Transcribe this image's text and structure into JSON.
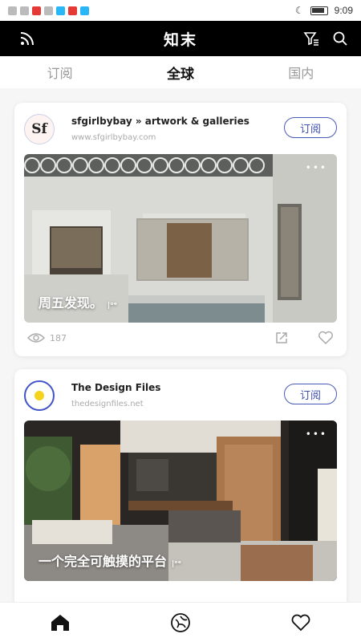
{
  "status": {
    "time": "9:09"
  },
  "app": {
    "title": "知末"
  },
  "tabs": [
    {
      "label": "订阅",
      "active": false
    },
    {
      "label": "全球",
      "active": true
    },
    {
      "label": "国内",
      "active": false
    }
  ],
  "cards": [
    {
      "avatar_text": "Sf",
      "source": "sfgirlbybay » artwork & galleries",
      "url": "www.sfgirlbybay.com",
      "subscribe_label": "订阅",
      "caption": "周五发现。",
      "views": "187"
    },
    {
      "source": "The Design Files",
      "url": "thedesignfiles.net",
      "subscribe_label": "订阅",
      "caption": "一个完全可触摸的平台"
    }
  ],
  "colors": {
    "accent": "#3d4db0",
    "app_bar": "#000000"
  },
  "icons": {
    "rss": "rss-icon",
    "filter": "filter-icon",
    "search": "search-icon",
    "home": "home-icon",
    "explore": "explore-icon",
    "favorites": "heart-icon"
  }
}
